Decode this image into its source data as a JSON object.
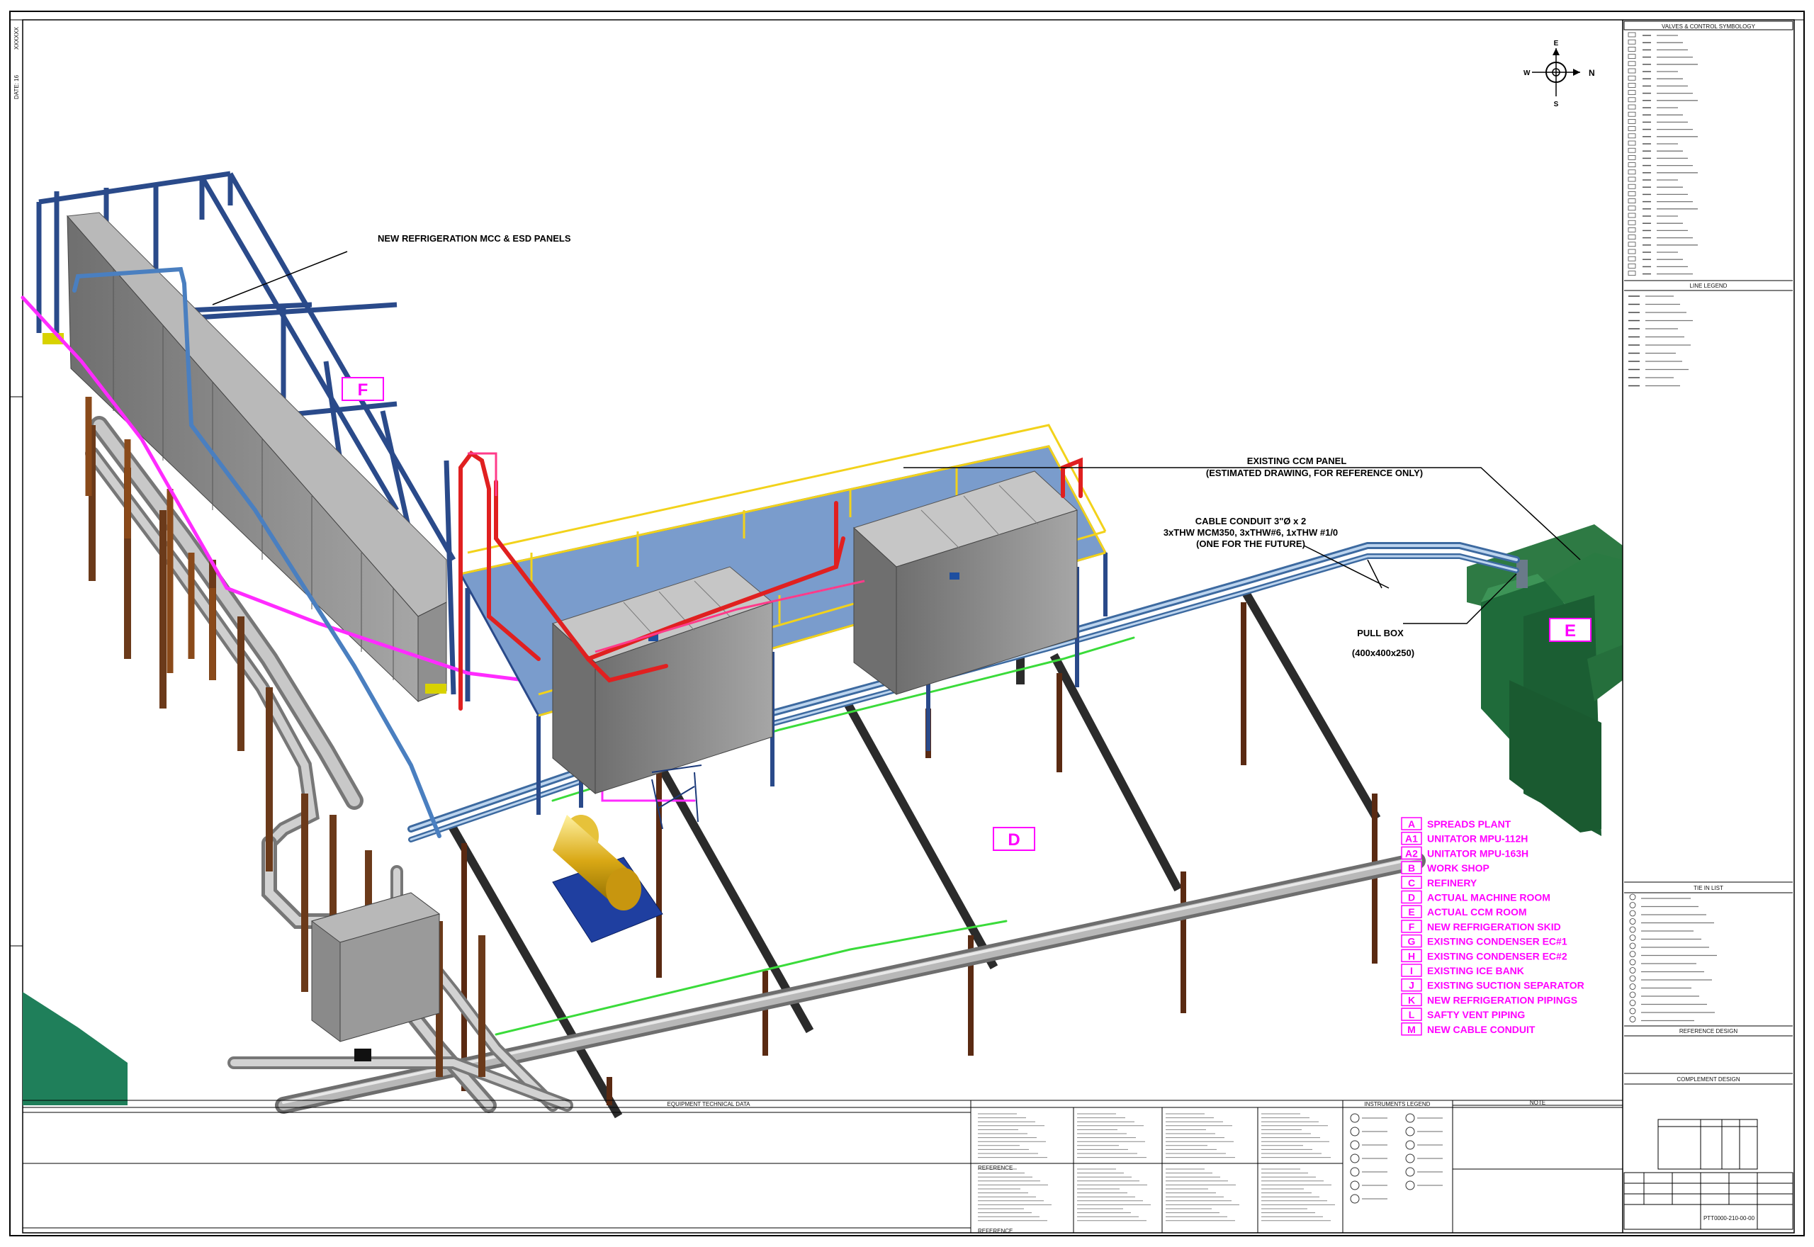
{
  "drawing": {
    "side_code": "XXXXXX",
    "side_date": "DATE: 16",
    "labels": {
      "mcc_panels": "NEW REFRIGERATION MCC & ESD PANELS",
      "ccm_panel_1": "EXISTING CCM PANEL",
      "ccm_panel_2": "(ESTIMATED DRAWING, FOR REFERENCE ONLY)",
      "conduit_1": "CABLE CONDUIT 3\"Ø x 2",
      "conduit_2": "3xTHW MCM350, 3xTHW#6, 1xTHW #1/0",
      "conduit_3": "(ONE FOR THE FUTURE)",
      "pull_box_1": "PULL BOX",
      "pull_box_2": "(400x400x250)"
    },
    "area_tags": {
      "f": "F",
      "e": "E",
      "d": "D"
    },
    "compass": {
      "n": "N",
      "e": "E",
      "s": "S",
      "w": "W"
    }
  },
  "legend": {
    "items": [
      {
        "code": "A",
        "text": "SPREADS PLANT"
      },
      {
        "code": "A1",
        "text": "UNITATOR MPU-112H"
      },
      {
        "code": "A2",
        "text": "UNITATOR MPU-163H"
      },
      {
        "code": "B",
        "text": "WORK SHOP"
      },
      {
        "code": "C",
        "text": "REFINERY"
      },
      {
        "code": "D",
        "text": "ACTUAL MACHINE ROOM"
      },
      {
        "code": "E",
        "text": "ACTUAL CCM ROOM"
      },
      {
        "code": "F",
        "text": "NEW REFRIGERATION SKID"
      },
      {
        "code": "G",
        "text": "EXISTING CONDENSER EC#1"
      },
      {
        "code": "H",
        "text": "EXISTING CONDENSER EC#2"
      },
      {
        "code": "I",
        "text": "EXISTING ICE BANK"
      },
      {
        "code": "J",
        "text": "EXISTING SUCTION SEPARATOR"
      },
      {
        "code": "K",
        "text": "NEW REFRIGERATION PIPINGS"
      },
      {
        "code": "L",
        "text": "SAFTY VENT PIPING"
      },
      {
        "code": "M",
        "text": "NEW CABLE CONDUIT"
      }
    ]
  },
  "sidebar": {
    "valves_title": "VALVES & CONTROL SYMBOLOGY",
    "line_legend_title": "LINE LEGEND",
    "tie_in_title": "TIE IN LIST",
    "reference_design": "REFERENCE DESIGN",
    "complement_design": "COMPLEMENT DESIGN",
    "drawing_number": "PTT0000-210-00-00"
  },
  "bottom": {
    "table_title": "EQUIPMENT TECHNICAL DATA",
    "instruments_legend": "INSTRUMENTS LEGEND",
    "note_title": "NOTE",
    "reference": "REFERENCE"
  },
  "colors": {
    "magenta": "#ff00ff",
    "pipe_blue": "#5a8fc8",
    "steel_navy": "#2a4a8a",
    "column_brown": "#6b3a1a",
    "handrail_yellow": "#f2d21b",
    "pipe_red": "#e02020",
    "building_green": "#1f6b3a",
    "panel_grey": "#8c8c8c",
    "tank_gold": "#d4a017"
  }
}
